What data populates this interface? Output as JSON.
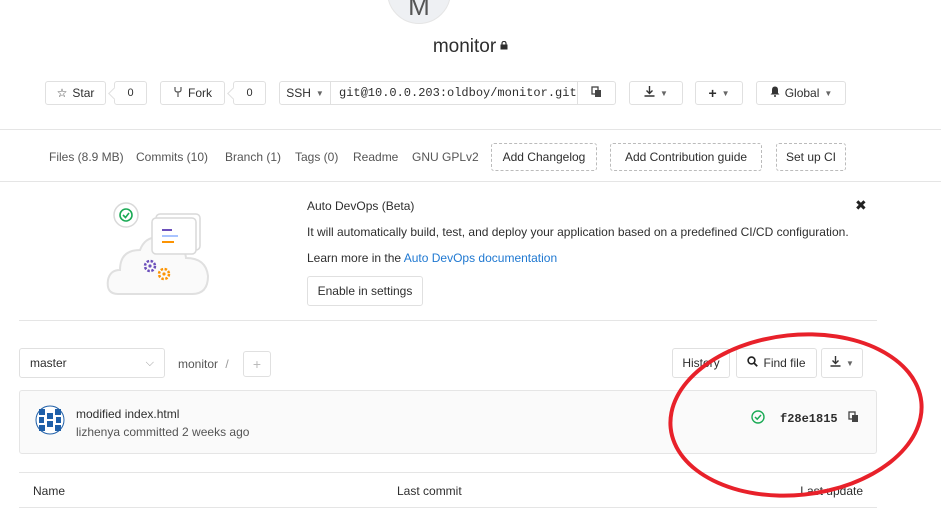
{
  "project": {
    "avatar_letter": "M",
    "name": "monitor",
    "lock_icon": "lock-icon"
  },
  "actions": {
    "star_label": "Star",
    "star_count": "0",
    "fork_label": "Fork",
    "fork_count": "0",
    "protocol_label": "SSH",
    "clone_url": "git@10.0.0.203:oldboy/monitor.git",
    "visibility_label": "Global"
  },
  "stats": {
    "files": "Files (8.9 MB)",
    "commits": "Commits (10)",
    "branch": "Branch (1)",
    "tags": "Tags (0)",
    "readme": "Readme",
    "license": "GNU GPLv2",
    "add_changelog": "Add Changelog",
    "add_contribution": "Add Contribution guide",
    "setup_ci": "Set up CI"
  },
  "devops": {
    "title": "Auto DevOps (Beta)",
    "description": "It will automatically build, test, and deploy your application based on a predefined CI/CD configuration.",
    "learn_prefix": "Learn more in the ",
    "learn_link": "Auto DevOps documentation",
    "enable_button": "Enable in settings"
  },
  "tree": {
    "branch": "master",
    "path": "monitor",
    "separator": "/",
    "history_label": "History",
    "find_file_label": "Find file"
  },
  "commit": {
    "message": "modified index.html",
    "meta": "lizhenya committed 2 weeks ago",
    "sha": "f28e1815",
    "status": "passed"
  },
  "table": {
    "col_name": "Name",
    "col_last_commit": "Last commit",
    "col_last_update": "Last update"
  },
  "colors": {
    "link": "#1f78d1",
    "success": "#1aaa55",
    "annotation": "#e8212a"
  }
}
